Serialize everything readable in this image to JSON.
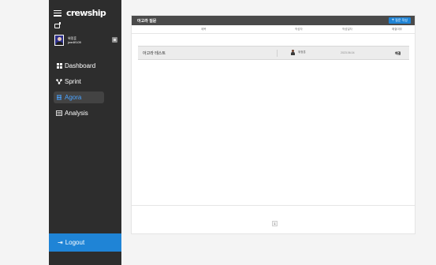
{
  "app": {
    "brand": "crewship"
  },
  "profile": {
    "name": "위정훈",
    "id": "jwe4fl109"
  },
  "nav": [
    {
      "label": "Dashboard",
      "icon": "grid-icon",
      "active": false
    },
    {
      "label": "Sprint",
      "icon": "sprint-icon",
      "active": false
    },
    {
      "label": "Agora",
      "icon": "agora-icon",
      "active": true
    },
    {
      "label": "Analysis",
      "icon": "analysis-icon",
      "active": false
    }
  ],
  "logout": {
    "label": "Logout"
  },
  "panel": {
    "title": "아고라 질문",
    "write_button": "질문 작성",
    "columns": [
      "제목",
      "작성자",
      "작성일자",
      "해결여부"
    ],
    "rows": [
      {
        "title": "아고라 테스트",
        "author": "위정훈",
        "date": "2023.06.04",
        "status": "해결"
      }
    ],
    "pagination": {
      "current": "1"
    }
  },
  "colors": {
    "sidebar": "#2d2d2d",
    "accent": "#1f84d6",
    "active_text": "#4aa3ff",
    "panel_header": "#4a4a4a"
  }
}
